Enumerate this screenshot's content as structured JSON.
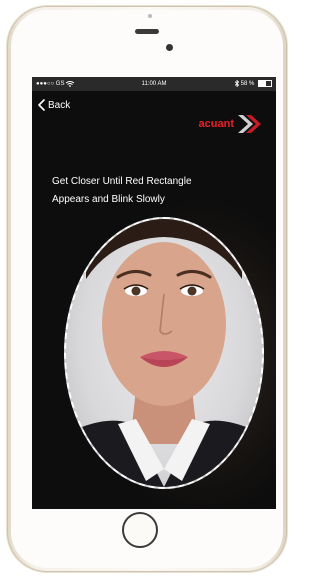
{
  "status_bar": {
    "signal": "●●●○○ GS",
    "time": "11:00 AM",
    "battery_text": "58 %",
    "battery_level": 0.58
  },
  "nav": {
    "back_label": "Back"
  },
  "brand": {
    "logo_text": "acuant"
  },
  "instructions": {
    "line1": "Get Closer Until Red Rectangle",
    "line2": "Appears and Blink Slowly"
  },
  "icons": {
    "back": "chevron-left-icon",
    "logo_mark": "acuant-logo-icon",
    "battery": "battery-icon",
    "wifi": "wifi-icon",
    "bluetooth": "bluetooth-icon"
  },
  "colors": {
    "accent": "#e8202a",
    "screen_bg": "#0d0d0d",
    "text": "#ffffff",
    "phone_body": "#f5f0e8"
  }
}
